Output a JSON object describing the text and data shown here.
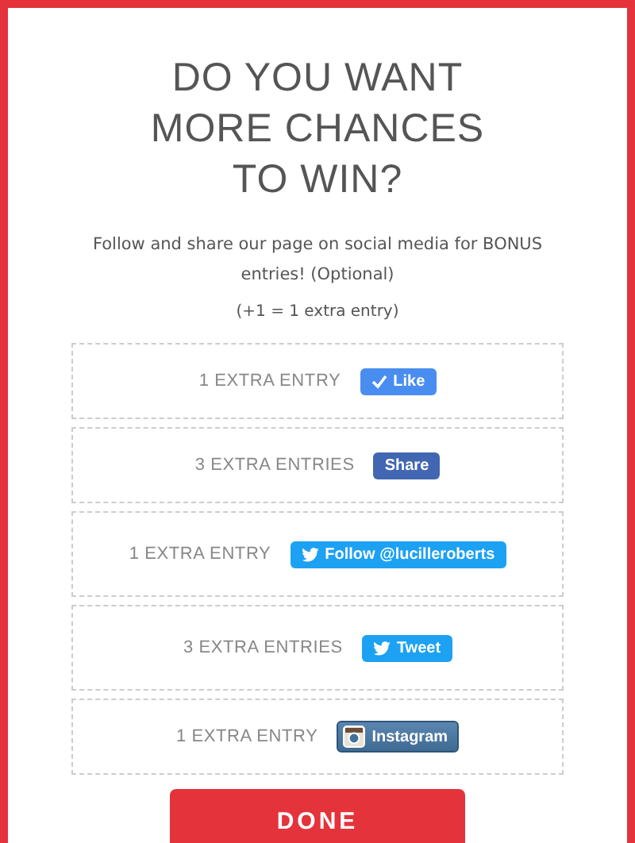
{
  "title": "DO YOU WANT MORE CHANCES TO WIN?",
  "description": "Follow and share our page on social media for BONUS entries! (Optional)",
  "note": "(+1 = 1 extra entry)",
  "entries": [
    {
      "label": "1 EXTRA ENTRY",
      "button": "Like",
      "kind": "like"
    },
    {
      "label": "3 EXTRA ENTRIES",
      "button": "Share",
      "kind": "share"
    },
    {
      "label": "1 EXTRA ENTRY",
      "button": "Follow @lucilleroberts",
      "kind": "twitter"
    },
    {
      "label": "3 EXTRA ENTRIES",
      "button": "Tweet",
      "kind": "twitter"
    },
    {
      "label": "1 EXTRA ENTRY",
      "button": "Instagram",
      "kind": "instagram"
    }
  ],
  "done": "DONE"
}
